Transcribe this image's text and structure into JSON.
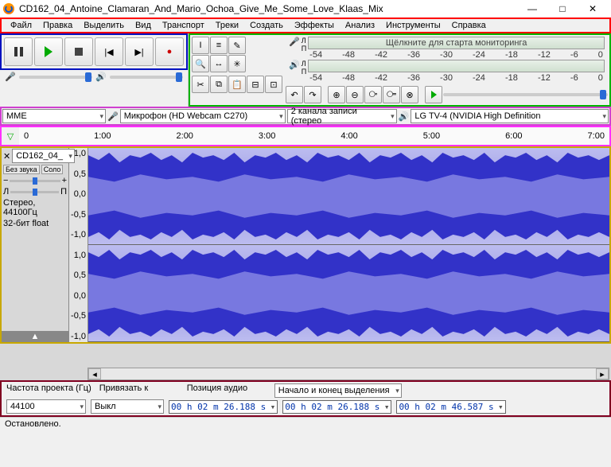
{
  "title": "CD162_04_Antoine_Clamaran_And_Mario_Ochoa_Give_Me_Some_Love_Klaas_Mix",
  "menu": [
    "Файл",
    "Правка",
    "Выделить",
    "Вид",
    "Транспорт",
    "Треки",
    "Создать",
    "Эффекты",
    "Анализ",
    "Инструменты",
    "Справка"
  ],
  "meter_hint": "Щёлкните для старта мониторинга",
  "meter_ticks": [
    "-54",
    "-48",
    "-42",
    "-36",
    "-30",
    "-24",
    "-18",
    "-12",
    "-6",
    "0"
  ],
  "devices": {
    "host": "MME",
    "input": "Микрофон (HD Webcam C270)",
    "channels": "2 канала записи (стерео",
    "output": "LG TV-4 (NVIDIA High Definition"
  },
  "timeline_ticks": [
    "0",
    "1:00",
    "2:00",
    "3:00",
    "4:00",
    "5:00",
    "6:00",
    "7:00"
  ],
  "track": {
    "name": "CD162_04_",
    "mute": "Без звука",
    "solo": "Соло",
    "format": "Стерео, 44100Гц",
    "bits": "32-бит float",
    "scale": [
      "1,0",
      "0,5",
      "0,0",
      "-0,5",
      "-1,0"
    ]
  },
  "status": {
    "rate_label": "Частота проекта (Гц)",
    "rate": "44100",
    "snap_label": "Привязать к",
    "snap": "Выкл",
    "pos_label": "Позиция аудио",
    "pos": "00 h 02 m 26.188 s",
    "sel_label": "Начало и конец выделения",
    "sel_start": "00 h 02 m 26.188 s",
    "sel_end": "00 h 02 m 46.587 s",
    "bar": "Остановлено."
  }
}
